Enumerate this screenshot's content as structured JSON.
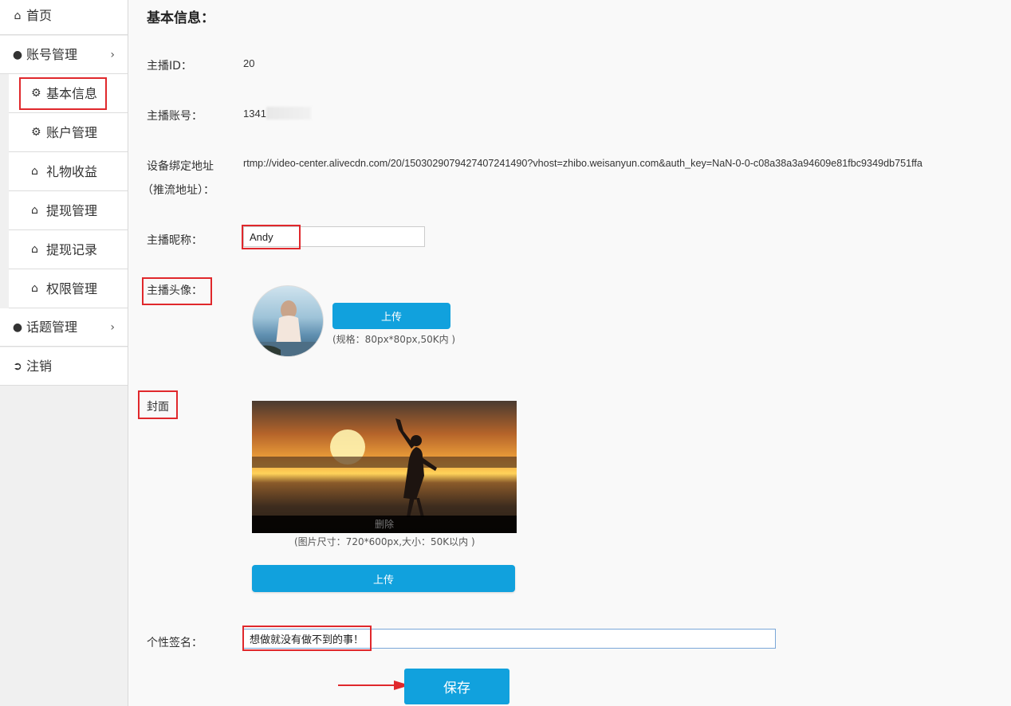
{
  "sidebar": {
    "home": "首页",
    "account": "账号管理",
    "sub_items": [
      "基本信息",
      "账户管理",
      "礼物收益",
      "提现管理",
      "提现记录",
      "权限管理"
    ],
    "topic": "话题管理",
    "logout": "注销"
  },
  "main": {
    "title": "基本信息：",
    "anchor_id_label": "主播ID：",
    "anchor_id_value": "20",
    "account_label": "主播账号：",
    "account_value": "1341",
    "rtmp_label_1": "设备绑定地址",
    "rtmp_label_2": "（推流地址）：",
    "rtmp_value": "rtmp://video-center.alivecdn.com/20/15030290794274072414​90?vhost=zhibo.weisanyun.com&auth_key=NaN-0-0-c08a38a3a94609e81fbc9349db751ffa",
    "nickname_label": "主播昵称：",
    "nickname_value": "Andy",
    "avatar_label": "主播头像：",
    "avatar_upload": "上传",
    "avatar_hint": "(规格：80px*80px,50K内 )",
    "cover_label": "封面",
    "cover_delete": "删除",
    "cover_hint": "(图片尺寸：720*600px,大小：50K以内 )",
    "cover_upload": "上传",
    "signature_label": "个性签名：",
    "signature_value": "想做就没有做不到的事！",
    "save": "保存"
  },
  "colors": {
    "accent": "#11a1dd",
    "highlight": "#e0282c"
  }
}
